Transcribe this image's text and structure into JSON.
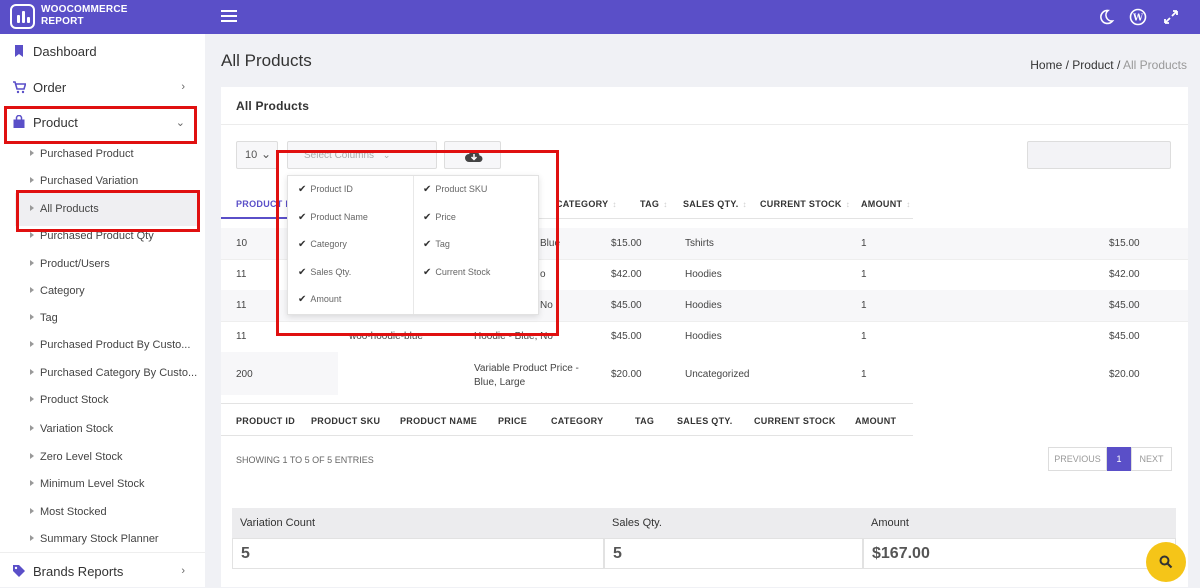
{
  "app": {
    "name_line1": "WOOCOMMERCE",
    "name_line2": "REPORT"
  },
  "sidebar": {
    "dashboard": "Dashboard",
    "order": "Order",
    "product": "Product",
    "brands": "Brands Reports",
    "subitems": [
      "Purchased Product",
      "Purchased Variation",
      "All Products",
      "Purchased Product Qty",
      "Product/Users",
      "Category",
      "Tag",
      "Purchased Product By Custo...",
      "Purchased Category By Custo...",
      "Product Stock",
      "Variation Stock",
      "Zero Level Stock",
      "Minimum Level Stock",
      "Most Stocked",
      "Summary Stock Planner"
    ]
  },
  "page": {
    "title": "All Products",
    "crumb_home": "Home",
    "crumb_sep": " / ",
    "crumb_product": "Product",
    "crumb_current": "All Products"
  },
  "card": {
    "title": "All Products"
  },
  "controls": {
    "page_size": "10",
    "select_columns": "Select Columns"
  },
  "table": {
    "headers_top": [
      "PRODUCT ID",
      "CATEGORY",
      "TAG",
      "SALES QTY.",
      "CURRENT STOCK",
      "AMOUNT"
    ],
    "rows": [
      {
        "id": "10",
        "name": "",
        "sku": "Blue",
        "price": "$15.00",
        "tag": "Tshirts",
        "qty": "1",
        "amount": "$15.00"
      },
      {
        "id": "11",
        "name": "",
        "sku": "o",
        "price": "$42.00",
        "tag": "Hoodies",
        "qty": "1",
        "amount": "$42.00"
      },
      {
        "id": "11",
        "name": "",
        "sku": "No",
        "price": "$45.00",
        "tag": "Hoodies",
        "qty": "1",
        "amount": "$45.00"
      },
      {
        "id": "11",
        "name": "woo-hoodie-blue",
        "sku": "Hoodie - Blue, No",
        "price": "$45.00",
        "tag": "Hoodies",
        "qty": "1",
        "amount": "$45.00"
      },
      {
        "id": "200",
        "name": "",
        "sku": "Variable Product Price - Blue, Large",
        "price": "$20.00",
        "tag": "Uncategorized",
        "qty": "1",
        "amount": "$20.00"
      }
    ],
    "headers_bottom": [
      "PRODUCT ID",
      "PRODUCT SKU",
      "PRODUCT NAME",
      "PRICE",
      "CATEGORY",
      "TAG",
      "SALES QTY.",
      "CURRENT STOCK",
      "AMOUNT"
    ]
  },
  "dropdown": {
    "left": [
      "Product ID",
      "Product Name",
      "Category",
      "Sales Qty.",
      "Amount"
    ],
    "right": [
      "Product SKU",
      "Price",
      "Tag",
      "Current Stock"
    ]
  },
  "footer": {
    "showing": "SHOWING 1 TO 5 OF 5 ENTRIES",
    "previous": "PREVIOUS",
    "page": "1",
    "next": "NEXT"
  },
  "summary": {
    "h1": "Variation Count",
    "h2": "Sales Qty.",
    "h3": "Amount",
    "v1": "5",
    "v2": "5",
    "v3": "$167.00"
  },
  "colors": {
    "accent": "#5a4fc8",
    "highlight": "#e01010",
    "fab": "#f5c518"
  },
  "icons": [
    "bar-chart-logo-icon",
    "menu-icon",
    "moon-icon",
    "wordpress-icon",
    "expand-icon",
    "bookmark-icon",
    "cart-icon",
    "bag-icon",
    "tag-icon",
    "download-cloud-icon",
    "search-icon",
    "checkmark-icon"
  ]
}
